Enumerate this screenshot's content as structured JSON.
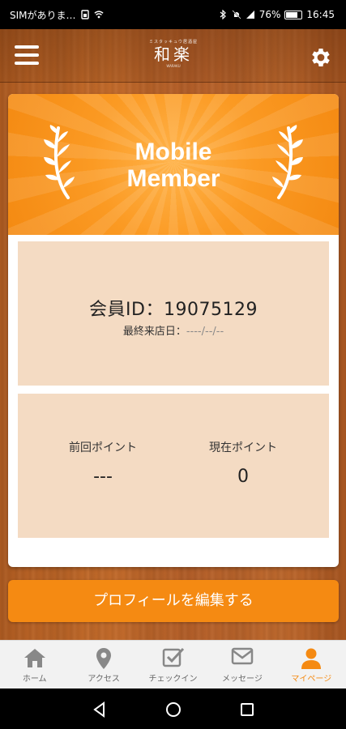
{
  "status_bar": {
    "carrier": "SIMがありま…",
    "battery": "76%",
    "time": "16:45"
  },
  "header": {
    "logo_small": "ミスタッキュウ居酒屋",
    "logo_main": "和楽",
    "logo_tiny": "WARAKU",
    "menu_icon": "hamburger-icon",
    "settings_icon": "gear-icon"
  },
  "card": {
    "banner_line1": "Mobile",
    "banner_line2": "Member",
    "member_id_label": "会員ID：19075129",
    "last_visit_label": "最終来店日：",
    "last_visit_value": "----/--/--",
    "prev_points_label": "前回ポイント",
    "prev_points_value": "---",
    "current_points_label": "現在ポイント",
    "current_points_value": "0"
  },
  "edit_button": {
    "label": "プロフィールを編集する"
  },
  "bottom_nav": {
    "items": [
      {
        "label": "ホーム",
        "icon": "home-icon",
        "active": false
      },
      {
        "label": "アクセス",
        "icon": "map-pin-icon",
        "active": false
      },
      {
        "label": "チェックイン",
        "icon": "checkin-icon",
        "active": false
      },
      {
        "label": "メッセージ",
        "icon": "mail-icon",
        "active": false
      },
      {
        "label": "マイページ",
        "icon": "user-icon",
        "active": true
      }
    ],
    "active_color": "#f58a12",
    "inactive_color": "#888888"
  },
  "colors": {
    "accent": "#f58a12",
    "panel": "#f4dbc3"
  }
}
